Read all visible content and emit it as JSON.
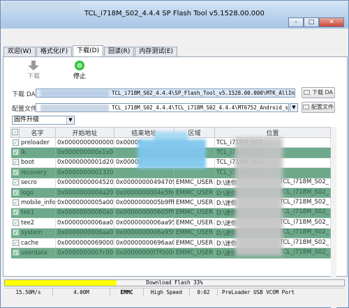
{
  "window": {
    "title": "TCL_i718M_S02_4.4.4  SP Flash Tool v5.1528.00.000",
    "buttons": [
      "minimize",
      "restore",
      "close"
    ]
  },
  "tabs": [
    "欢迎(W)",
    "格式化(F)",
    "下载(D)",
    "回读(R)",
    "内存测试(E)"
  ],
  "active_tab": "下载(D)",
  "toolbar": {
    "download_label": "下载",
    "stop_label": "停止"
  },
  "download_agent": {
    "label": "下载 DA",
    "path": "TCL_i718M_S02_4.4.4\\SP_Flash_Tool_v5.1528.00.000\\MTK_AllInOne_DA.bin",
    "button": "下载 DA"
  },
  "config": {
    "label": "配置文件",
    "path": "TCL_i718M_S02_4.4.4\\TCL_i718M_S02_4.4.4\\MT6752_Android_scatter.txt",
    "button": "配置文件"
  },
  "mode_select": {
    "value": "固件升级"
  },
  "table": {
    "headers": [
      "",
      "名字",
      "开始地址",
      "结束地址",
      "区域",
      "位置"
    ],
    "rows": [
      {
        "checked": true,
        "name": "preloader",
        "start": "0x0000000000000000",
        "end": "0x00000",
        "region": "",
        "location": "TCL_i718M_S02_",
        "style": "wh"
      },
      {
        "checked": true,
        "name": "lk",
        "start": "0x000000000x1x00000",
        "end": "",
        "region": "",
        "location": "TCL_i718M_S02_",
        "style": "gr"
      },
      {
        "checked": true,
        "name": "boot",
        "start": "0x0000000001d20000",
        "end": "0x00000",
        "region": "",
        "location": "TCL_i718M_S02_",
        "style": "wh"
      },
      {
        "checked": true,
        "name": "recovery",
        "start": "0x0000000001320000",
        "end": "",
        "region": "",
        "location": "TCL_i718M_S02_",
        "style": "gr"
      },
      {
        "checked": true,
        "name": "secro",
        "start": "0x0000000004520000",
        "end": "0x00000000494709f",
        "region": "EMMC_USER",
        "location": "D:\\迷你",
        "location_end": "TCL_i718M_S02_",
        "style": "wh"
      },
      {
        "checked": true,
        "name": "logo",
        "start": "0x0000000004a20000",
        "end": "0x0000000004e5fe6f",
        "region": "EMMC_USER",
        "location": "D:\\迷你",
        "location_end": "TCL_i718M_S02_",
        "style": "gr"
      },
      {
        "checked": true,
        "name": "mobile_info",
        "start": "0x0000000005a0000",
        "end": "0x0000000005b9ffff",
        "region": "EMMC_USER",
        "location": "D:\\迷你",
        "location_end": "TCL_i718M_S02_",
        "style": "wh"
      },
      {
        "checked": true,
        "name": "tee1",
        "start": "0x00000000060a0000",
        "end": "0x000000000605fff",
        "region": "EMMC_USER",
        "location": "D:\\迷你",
        "location_end": "TCL_i718M_S02_",
        "style": "gr"
      },
      {
        "checked": true,
        "name": "tee2",
        "start": "0x0000000006aa0000",
        "end": "0x0000000006aa95ff",
        "region": "EMMC_USER",
        "location": "D:\\迷你",
        "location_end": "TCL_i718M_S02_",
        "style": "wh"
      },
      {
        "checked": true,
        "name": "system",
        "start": "0x0000000006aa0000",
        "end": "0x0000000006a95ff",
        "region": "EMMC_USER",
        "location": "D:\\迷你",
        "location_end": "TCL_i718M_S02_",
        "style": "gr"
      },
      {
        "checked": true,
        "name": "cache",
        "start": "0x0000000069000000",
        "end": "0x00000000696aa0e7",
        "region": "EMMC_USER",
        "location": "D:\\迷你",
        "location_end": "TCL_i718M_S02_",
        "style": "wh"
      },
      {
        "checked": true,
        "name": "userdata",
        "start": "0x0000000007c00000",
        "end": "0x00000000f7f0000",
        "region": "EMMC_USER",
        "location": "D:\\迷你",
        "location_end": "TCL_i718M_S02_",
        "style": "gr"
      }
    ]
  },
  "status": {
    "progress_text": "Download Flash 33%",
    "progress_fraction": 0.33,
    "speed": "15.50M/s",
    "size": "4.00M",
    "storage": "EMMC",
    "mode": "High Speed",
    "time": "0:02",
    "port": "PreLoader USB VCOM Port"
  },
  "colors": {
    "green_row": "#6fa98b",
    "progress": "#ffff00",
    "title": "#b7d0ea"
  }
}
